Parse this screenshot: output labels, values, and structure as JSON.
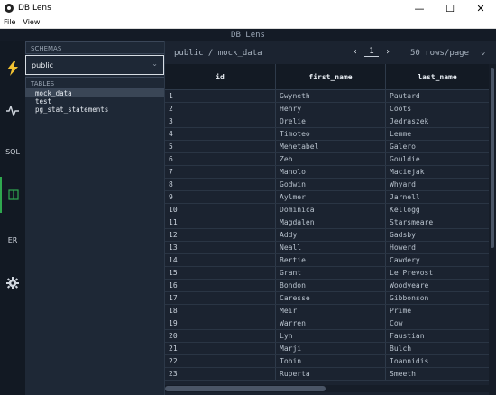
{
  "window": {
    "title": "DB Lens",
    "minimize": "—",
    "maximize": "☐",
    "close": "✕"
  },
  "menu": {
    "file": "File",
    "view": "View"
  },
  "app": {
    "title": "DB Lens"
  },
  "nav": {
    "sql": "SQL",
    "er": "ER"
  },
  "sidebar": {
    "schemas_label": "SCHEMAS",
    "schema_value": "public",
    "tables_label": "TABLES",
    "tables": [
      "mock_data",
      "test",
      "pg_stat_statements"
    ]
  },
  "toolbar": {
    "breadcrumb": "public / mock_data",
    "prev": "‹",
    "page": "1",
    "next": "›",
    "rows_per_page": "50 rows/page"
  },
  "grid": {
    "columns": [
      "id",
      "first_name",
      "last_name"
    ],
    "rows": [
      [
        "1",
        "Gwyneth",
        "Pautard"
      ],
      [
        "2",
        "Henry",
        "Coots"
      ],
      [
        "3",
        "Orelie",
        "Jedraszek"
      ],
      [
        "4",
        "Timoteo",
        "Lemme"
      ],
      [
        "5",
        "Mehetabel",
        "Galero"
      ],
      [
        "6",
        "Zeb",
        "Gouldie"
      ],
      [
        "7",
        "Manolo",
        "Maciejak"
      ],
      [
        "8",
        "Godwin",
        "Whyard"
      ],
      [
        "9",
        "Aylmer",
        "Jarnell"
      ],
      [
        "10",
        "Dominica",
        "Kellogg"
      ],
      [
        "11",
        "Magdalen",
        "Starsmeare"
      ],
      [
        "12",
        "Addy",
        "Gadsby"
      ],
      [
        "13",
        "Neall",
        "Howerd"
      ],
      [
        "14",
        "Bertie",
        "Cawdery"
      ],
      [
        "15",
        "Grant",
        "Le Prevost"
      ],
      [
        "16",
        "Bondon",
        "Woodyeare"
      ],
      [
        "17",
        "Caresse",
        "Gibbonson"
      ],
      [
        "18",
        "Meir",
        "Prime"
      ],
      [
        "19",
        "Warren",
        "Cow"
      ],
      [
        "20",
        "Lyn",
        "Faustian"
      ],
      [
        "21",
        "Marji",
        "Bulch"
      ],
      [
        "22",
        "Tobin",
        "Ioannidis"
      ],
      [
        "23",
        "Ruperta",
        "Smeeth"
      ]
    ]
  },
  "colors": {
    "accent": "#2fa84f",
    "background": "#1b2330",
    "sidebar": "#1e2836"
  }
}
